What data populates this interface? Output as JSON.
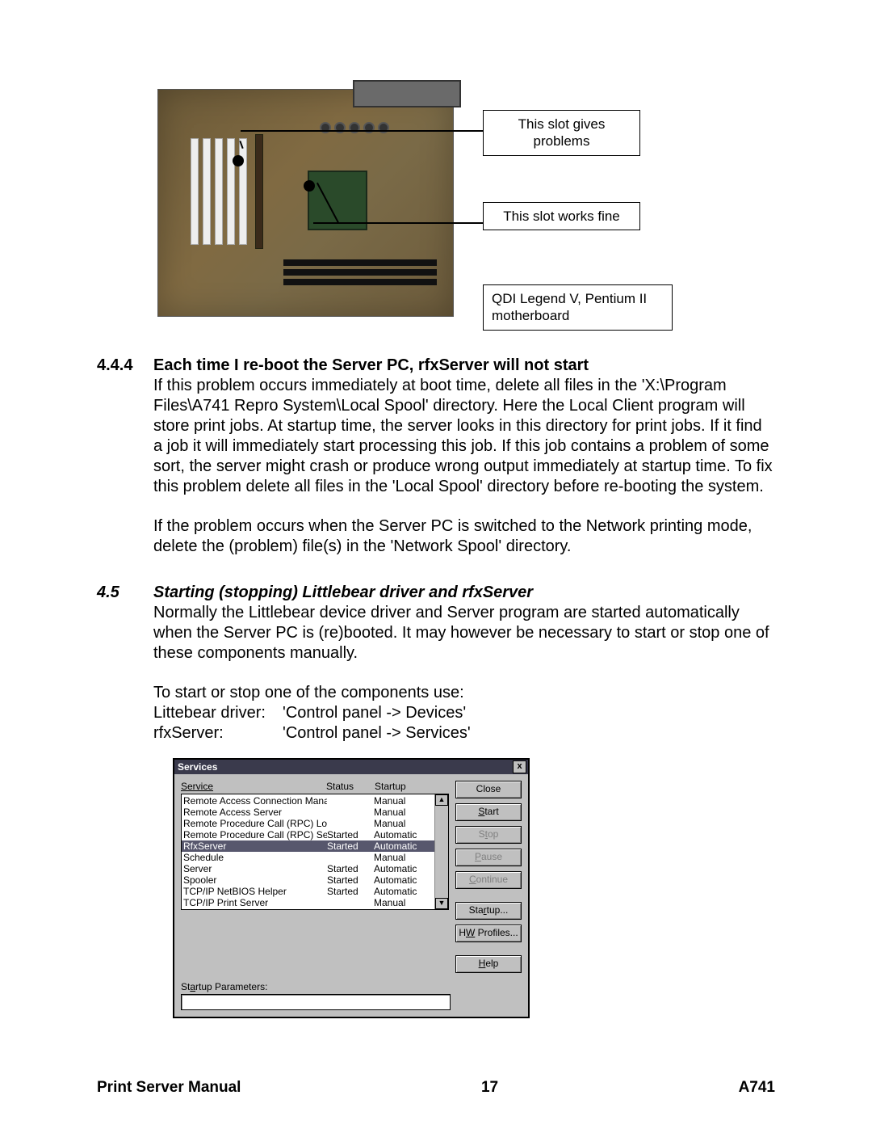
{
  "figure": {
    "callout_problem": "This slot gives problems",
    "callout_fine": "This slot works fine",
    "caption": "QDI Legend V, Pentium II motherboard"
  },
  "sec444": {
    "num": "4.4.4",
    "title": "Each time I re-boot the Server PC, rfxServer will not start",
    "para1": "If this problem occurs immediately at boot time, delete all files in the 'X:\\Program Files\\A741 Repro System\\Local Spool' directory. Here the Local Client program will store print jobs. At startup time, the server looks in this directory for print jobs. If it find a job it will immediately start processing this job. If this job contains a problem of some sort, the server might crash or produce wrong output immediately at startup time. To fix this problem delete all files in the 'Local Spool' directory before re-booting the system.",
    "para2": "If the problem occurs when the Server PC is switched to the Network printing mode, delete the (problem) file(s) in the 'Network Spool' directory."
  },
  "sec45": {
    "num": "4.5",
    "title": "Starting (stopping) Littlebear driver and rfxServer",
    "para1": "Normally the Littlebear device driver and Server program are started automatically when the Server PC is (re)booted. It may however be necessary to start or stop one of these components manually.",
    "lead": "To start or stop one of the components use:",
    "row1_l": "Littebear driver:",
    "row1_r": "'Control panel -> Devices'",
    "row2_l": "rfxServer:",
    "row2_r": "'Control panel -> Services'"
  },
  "dialog": {
    "title": "Services",
    "close": "x",
    "head_service": "Service",
    "head_status": "Status",
    "head_startup": "Startup",
    "rows": [
      {
        "svc": "Remote Access Connection Manager",
        "stat": "",
        "start": "Manual",
        "sel": false
      },
      {
        "svc": "Remote Access Server",
        "stat": "",
        "start": "Manual",
        "sel": false
      },
      {
        "svc": "Remote Procedure Call (RPC) Locator",
        "stat": "",
        "start": "Manual",
        "sel": false
      },
      {
        "svc": "Remote Procedure Call (RPC) Service",
        "stat": "Started",
        "start": "Automatic",
        "sel": false
      },
      {
        "svc": "RfxServer",
        "stat": "Started",
        "start": "Automatic",
        "sel": true
      },
      {
        "svc": "Schedule",
        "stat": "",
        "start": "Manual",
        "sel": false
      },
      {
        "svc": "Server",
        "stat": "Started",
        "start": "Automatic",
        "sel": false
      },
      {
        "svc": "Spooler",
        "stat": "Started",
        "start": "Automatic",
        "sel": false
      },
      {
        "svc": "TCP/IP NetBIOS Helper",
        "stat": "Started",
        "start": "Automatic",
        "sel": false
      },
      {
        "svc": "TCP/IP Print Server",
        "stat": "",
        "start": "Manual",
        "sel": false
      }
    ],
    "btn_close": "Close",
    "btn_start": "Start",
    "btn_stop": "Stop",
    "btn_pause": "Pause",
    "btn_continue": "Continue",
    "btn_startup": "Startup...",
    "btn_hwprofiles": "HW Profiles...",
    "btn_help": "Help",
    "startup_params_label": "Startup Parameters:"
  },
  "footer": {
    "left": "Print Server Manual",
    "center": "17",
    "right": "A741"
  }
}
